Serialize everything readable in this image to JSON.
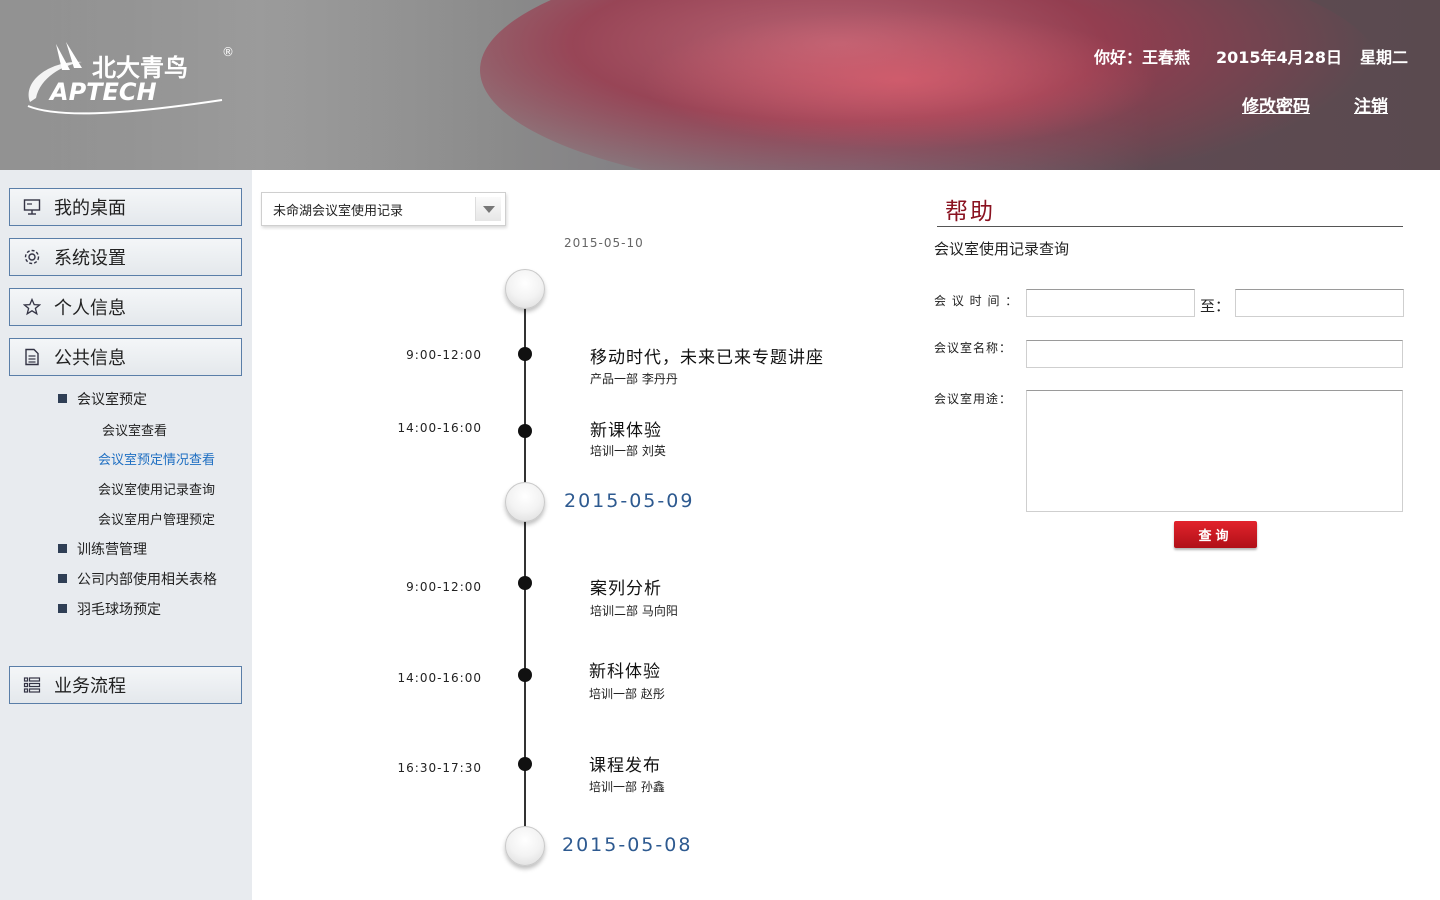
{
  "header": {
    "logo_cn": "北大青鸟",
    "logo_en": "APTECH",
    "logo_reg": "®",
    "greeting": "你好：王春燕",
    "date": "2015年4月28日",
    "weekday": "星期二",
    "change_password": "修改密码",
    "logout": "注销"
  },
  "sidebar": {
    "desktop": "我的桌面",
    "settings": "系统设置",
    "personal": "个人信息",
    "public": "公共信息",
    "public_items": [
      "会议室预定",
      "训练营管理",
      "公司内部使用相关表格",
      "羽毛球场预定"
    ],
    "meeting_subitems": [
      "会议室查看",
      "会议室预定情况查看",
      "会议室使用记录查询",
      "会议室用户管理预定"
    ],
    "workflow": "业务流程"
  },
  "main": {
    "room_select": "未命湖会议室使用记录",
    "top_date": "2015-05-10",
    "date_2": "2015-05-09",
    "date_3": "2015-05-08",
    "events": [
      {
        "time": "9:00-12:00",
        "title": "移动时代，未来已来专题讲座",
        "meta": "产品一部   李丹丹"
      },
      {
        "time": "14:00-16:00",
        "title": "新课体验",
        "meta": "培训一部   刘英"
      },
      {
        "time": "9:00-12:00",
        "title": "案列分析",
        "meta": "培训二部   马向阳"
      },
      {
        "time": "14:00-16:00",
        "title": "新科体验",
        "meta": "培训一部   赵彤"
      },
      {
        "time": "16:30-17:30",
        "title": "课程发布",
        "meta": "培训一部   孙鑫"
      }
    ]
  },
  "help": {
    "title": "帮助",
    "subtitle": "会议室使用记录查询",
    "time_label": "会 议 时 间 ：",
    "to_label": "至：",
    "name_label": "会议室名称：",
    "purpose_label": "会议室用途：",
    "query_button": "查询"
  }
}
